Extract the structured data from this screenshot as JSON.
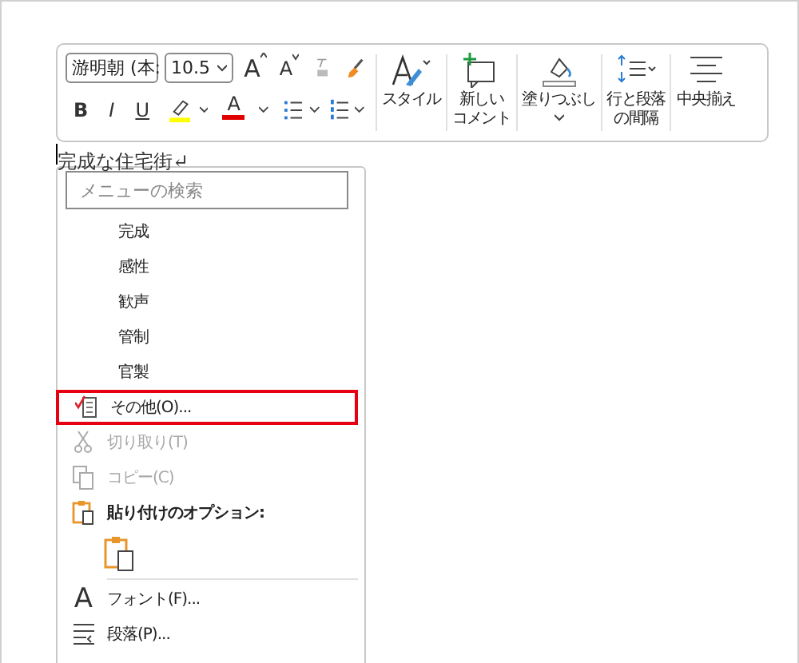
{
  "toolbar": {
    "font_name": "游明朝 (本:",
    "font_size": "10.5",
    "grow_font": "A",
    "shrink_font": "A",
    "bold": "B",
    "italic": "I",
    "underline": "U",
    "highlight": {
      "color": "#ffff00"
    },
    "font_color": {
      "label": "A",
      "color": "#e00000"
    },
    "buttons": [
      {
        "kind": "style",
        "lines": [
          "スタイル"
        ]
      },
      {
        "kind": "comment",
        "lines": [
          "新しい",
          "コメント"
        ]
      },
      {
        "kind": "fill",
        "lines": [
          "塗りつぶし"
        ],
        "dropdown": true
      },
      {
        "kind": "spacing",
        "lines": [
          "行と段落",
          "の間隔"
        ]
      },
      {
        "kind": "center",
        "lines": [
          "中央揃え"
        ]
      }
    ]
  },
  "document": {
    "text": "完成な住宅街↵"
  },
  "menu": {
    "search": {
      "placeholder": "メニューの検索"
    },
    "items": [
      {
        "kind": "suggestion",
        "label": "完成"
      },
      {
        "kind": "suggestion",
        "label": "感性"
      },
      {
        "kind": "suggestion",
        "label": "歓声"
      },
      {
        "kind": "suggestion",
        "label": "管制"
      },
      {
        "kind": "suggestion",
        "label": "官製"
      },
      {
        "kind": "more",
        "label": "その他(O)...",
        "highlighted": true,
        "disabled": false
      },
      {
        "kind": "cut",
        "label": "切り取り(T)",
        "highlighted": false,
        "disabled": true
      },
      {
        "kind": "copy",
        "label": "コピー(C)",
        "highlighted": false,
        "disabled": true
      },
      {
        "kind": "paste-header",
        "label": "貼り付けのオプション:"
      },
      {
        "kind": "paste-option"
      },
      {
        "kind": "separator"
      },
      {
        "kind": "font",
        "glyph": "A",
        "label": "フォント(F)...",
        "highlighted": false,
        "disabled": false
      },
      {
        "kind": "paragraph",
        "label": "段落(P)...",
        "highlighted": false,
        "disabled": false
      }
    ]
  }
}
